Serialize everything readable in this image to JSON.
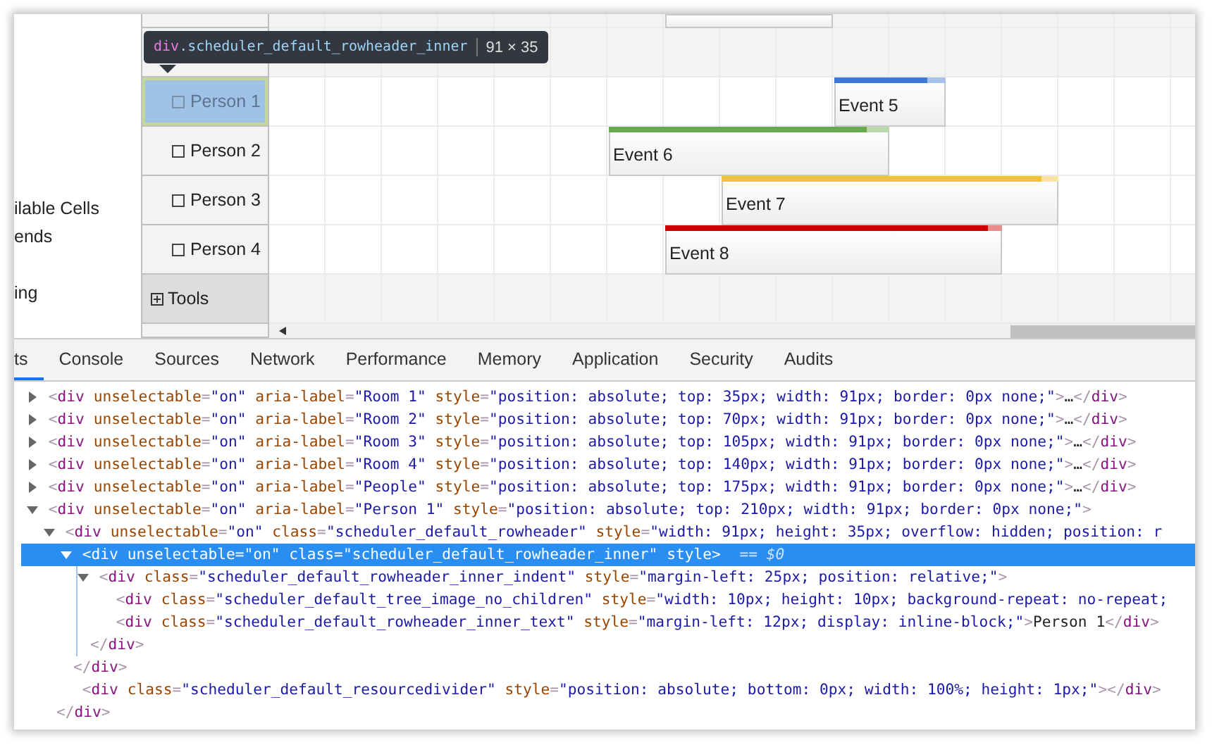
{
  "left_panel": [
    {
      "items": [
        "ilable Cells",
        "ends"
      ]
    },
    {
      "items": [
        "ing"
      ]
    }
  ],
  "tooltip": {
    "tag": "div",
    "selector": ".scheduler_default_rowheader_inner",
    "size": "91 × 35"
  },
  "scheduler": {
    "rows": [
      {
        "name": "Person 1",
        "selected": true,
        "checked": false,
        "event": {
          "text": "Event 5",
          "color": "#3c78d8",
          "level": 0.83
        }
      },
      {
        "name": "Person 2",
        "selected": false,
        "checked": false,
        "event": {
          "text": "Event 6",
          "color": "#6aa84f",
          "level": 0.92
        }
      },
      {
        "name": "Person 3",
        "selected": false,
        "checked": false,
        "event": {
          "text": "Event 7",
          "color": "#f1c232",
          "level": 0.95
        }
      },
      {
        "name": "Person 4",
        "selected": false,
        "checked": false,
        "event": {
          "text": "Event 8",
          "color": "#cc0000",
          "level": 0.96
        }
      }
    ],
    "group": {
      "name": "Tools",
      "expanded": false
    }
  },
  "devtools": {
    "tabs": [
      {
        "label": "ts",
        "selected": true
      },
      {
        "label": "Console",
        "selected": false
      },
      {
        "label": "Sources",
        "selected": false
      },
      {
        "label": "Network",
        "selected": false
      },
      {
        "label": "Performance",
        "selected": false
      },
      {
        "label": "Memory",
        "selected": false
      },
      {
        "label": "Application",
        "selected": false
      },
      {
        "label": "Security",
        "selected": false
      },
      {
        "label": "Audits",
        "selected": false
      }
    ],
    "dom_tree": [
      {
        "text": "<div unselectable=\"on\" aria-label=\"Room 1\" style=\"position: absolute; top: 35px; width: 91px; border: 0px none;\">…</div>",
        "expanded": false,
        "selected": false
      },
      {
        "text": "<div unselectable=\"on\" aria-label=\"Room 2\" style=\"position: absolute; top: 70px; width: 91px; border: 0px none;\">…</div>",
        "expanded": false,
        "selected": false
      },
      {
        "text": "<div unselectable=\"on\" aria-label=\"Room 3\" style=\"position: absolute; top: 105px; width: 91px; border: 0px none;\">…</div>",
        "expanded": false,
        "selected": false
      },
      {
        "text": "<div unselectable=\"on\" aria-label=\"Room 4\" style=\"position: absolute; top: 140px; width: 91px; border: 0px none;\">…</div>",
        "expanded": false,
        "selected": false
      },
      {
        "text": "<div unselectable=\"on\" aria-label=\"People\" style=\"position: absolute; top: 175px; width: 91px; border: 0px none;\">…</div>",
        "expanded": false,
        "selected": false
      },
      {
        "text": "<div unselectable=\"on\" aria-label=\"Person 1\" style=\"position: absolute; top: 210px; width: 91px; border: 0px none;\">",
        "expanded": true,
        "selected": false,
        "children": [
          {
            "text": "<div unselectable=\"on\" class=\"scheduler_default_rowheader\" style=\"width: 91px; height: 35px; overflow: hidden; position: r",
            "expanded": true,
            "selected": false,
            "close": "</div>",
            "children": [
              {
                "text": "<div unselectable=\"on\" class=\"scheduler_default_rowheader_inner\" style>",
                "expanded": true,
                "selected": true,
                "marker": "== $0",
                "close": "</div>",
                "children": [
                  {
                    "text": "<div class=\"scheduler_default_rowheader_inner_indent\" style=\"margin-left: 25px; position: relative;\">",
                    "expanded": true,
                    "selected": false,
                    "close": "</div>",
                    "children": [
                      {
                        "text": "<div class=\"scheduler_default_tree_image_no_children\" style=\"width: 10px; height: 10px; background-repeat: no-repeat;",
                        "selected": false
                      },
                      {
                        "text": "<div class=\"scheduler_default_rowheader_inner_text\" style=\"margin-left: 12px; display: inline-block;\">Person 1</div>",
                        "selected": false
                      }
                    ]
                  }
                ]
              },
              {
                "text": "<div class=\"scheduler_default_resourcedivider\" style=\"position: absolute; bottom: 0px; width: 100%; height: 1px;\"></div>",
                "selected": false
              }
            ]
          }
        ]
      }
    ]
  }
}
